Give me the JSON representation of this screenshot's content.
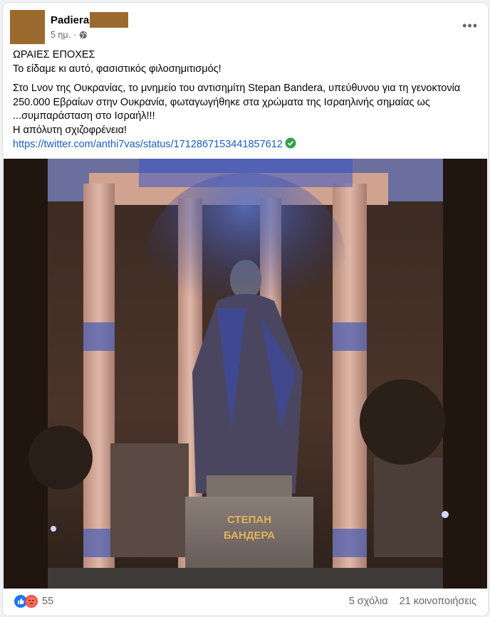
{
  "post": {
    "author": "Padiera",
    "time": "5 ημ.",
    "dot": "·",
    "more": "•••",
    "lines": {
      "l1": "ΩΡΑΙΕΣ ΕΠΟΧΕΣ",
      "l2": "Το είδαμε κι αυτό, φασιστικός φιλοσημιτισμός!",
      "l3": "Στο Lνον της Ουκρανίας, το μνημείο του αντισημίτη  Stepan Bandera, υπεύθυνου για τη γενοκτονία 250.000 Εβραίων στην Ουκρανία, φωταγωγήθηκε στα χρώματα της Ισραηλινής σημαίας ως ...συμπαράσταση στο Ισραήλ!!!",
      "l4": "Η απόλυτη σχιζοφρένεια!"
    },
    "link": "https://twitter.com/anthi7vas/status/1712867153441857612",
    "photo": {
      "inscription_1": "СТЕПАН",
      "inscription_2": "БАНДЕРА"
    }
  },
  "footer": {
    "reaction_count": "55",
    "comments": "5 σχόλια",
    "shares": "21 κοινοποιήσεις"
  },
  "colors": {
    "accent": "#1b5fbd",
    "verified": "#31a24c",
    "like": "#1877f2",
    "angry": "#f33e58"
  }
}
